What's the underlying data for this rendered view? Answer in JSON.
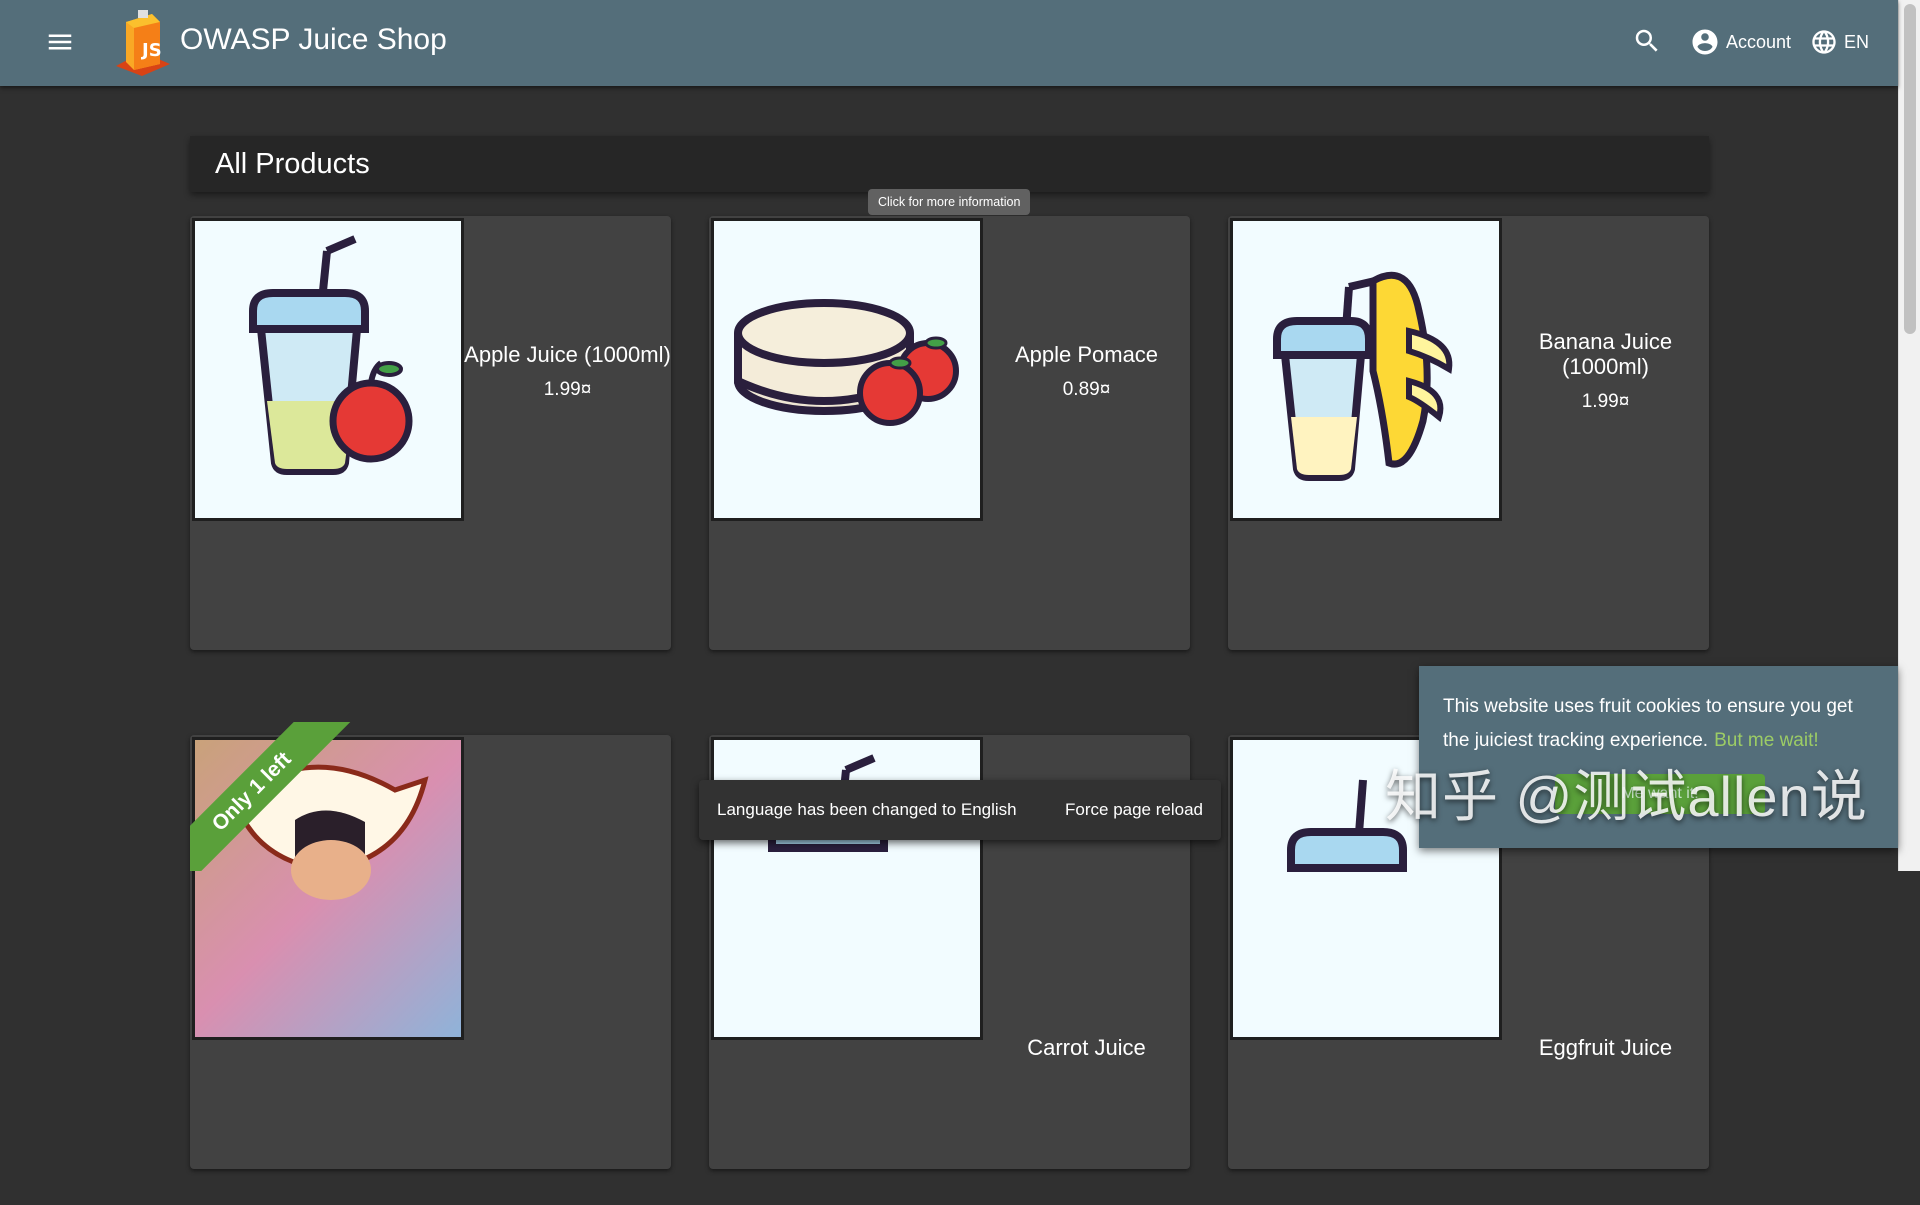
{
  "header": {
    "app_title": "OWASP Juice Shop",
    "account_label": "Account",
    "language_label": "EN",
    "brand_color": "#546e7a",
    "icons": {
      "menu": "menu-icon",
      "search": "search-icon",
      "account": "account-circle-icon",
      "language": "globe-icon"
    }
  },
  "main": {
    "heading": "All Products",
    "tooltip": "Click for more information",
    "products": [
      {
        "name": "Apple Juice (1000ml)",
        "price": "1.99¤"
      },
      {
        "name": "Apple Pomace",
        "price": "0.89¤"
      },
      {
        "name": "Banana Juice (1000ml)",
        "price": "1.99¤"
      },
      {
        "name": "",
        "price": "",
        "badge": "Only 1 left"
      },
      {
        "name": "Carrot Juice",
        "price": ""
      },
      {
        "name": "Eggfruit Juice",
        "price": ""
      }
    ]
  },
  "snackbar": {
    "message": "Language has been changed to English",
    "action": "Force page reload"
  },
  "cookie_banner": {
    "message": "This website uses fruit cookies to ensure you get the juiciest tracking experience.",
    "learn_more": "But me wait!",
    "dismiss": "Me want it!"
  },
  "watermark": "知乎 @测试allen说"
}
